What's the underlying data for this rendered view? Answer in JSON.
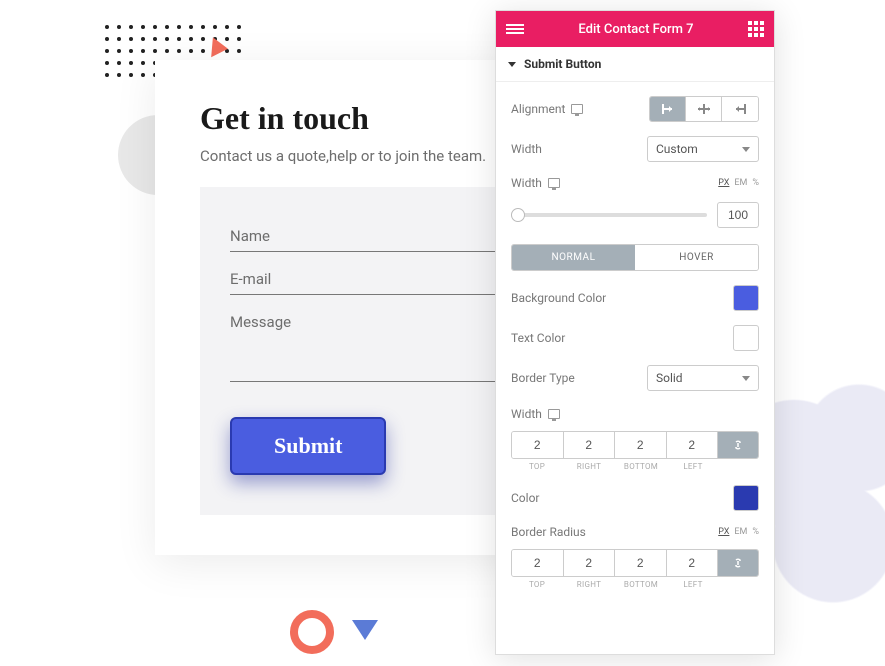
{
  "form": {
    "title": "Get in touch",
    "subtitle": "Contact us a quote,help or to join the team.",
    "fields": {
      "name": "Name",
      "email": "E-mail",
      "message": "Message"
    },
    "submit_label": "Submit"
  },
  "panel": {
    "title": "Edit Contact Form 7",
    "section": "Submit Button",
    "alignment_label": "Alignment",
    "width_select_label": "Width",
    "width_select_value": "Custom",
    "width_slider_label": "Width",
    "width_value": "100",
    "units": {
      "px": "PX",
      "em": "EM",
      "pct": "%"
    },
    "tabs": {
      "normal": "NORMAL",
      "hover": "HOVER"
    },
    "bg_color_label": "Background Color",
    "bg_color": "#4a5de0",
    "text_color_label": "Text Color",
    "text_color": "#ffffff",
    "border_type_label": "Border Type",
    "border_type_value": "Solid",
    "border_width_label": "Width",
    "border_width": {
      "top": "2",
      "right": "2",
      "bottom": "2",
      "left": "2"
    },
    "border_color_label": "Color",
    "border_color": "#2a3ab0",
    "radius_label": "Border Radius",
    "radius": {
      "top": "2",
      "right": "2",
      "bottom": "2",
      "left": "2"
    },
    "dim_labels": {
      "top": "TOP",
      "right": "RIGHT",
      "bottom": "BOTTOM",
      "left": "LEFT"
    }
  }
}
